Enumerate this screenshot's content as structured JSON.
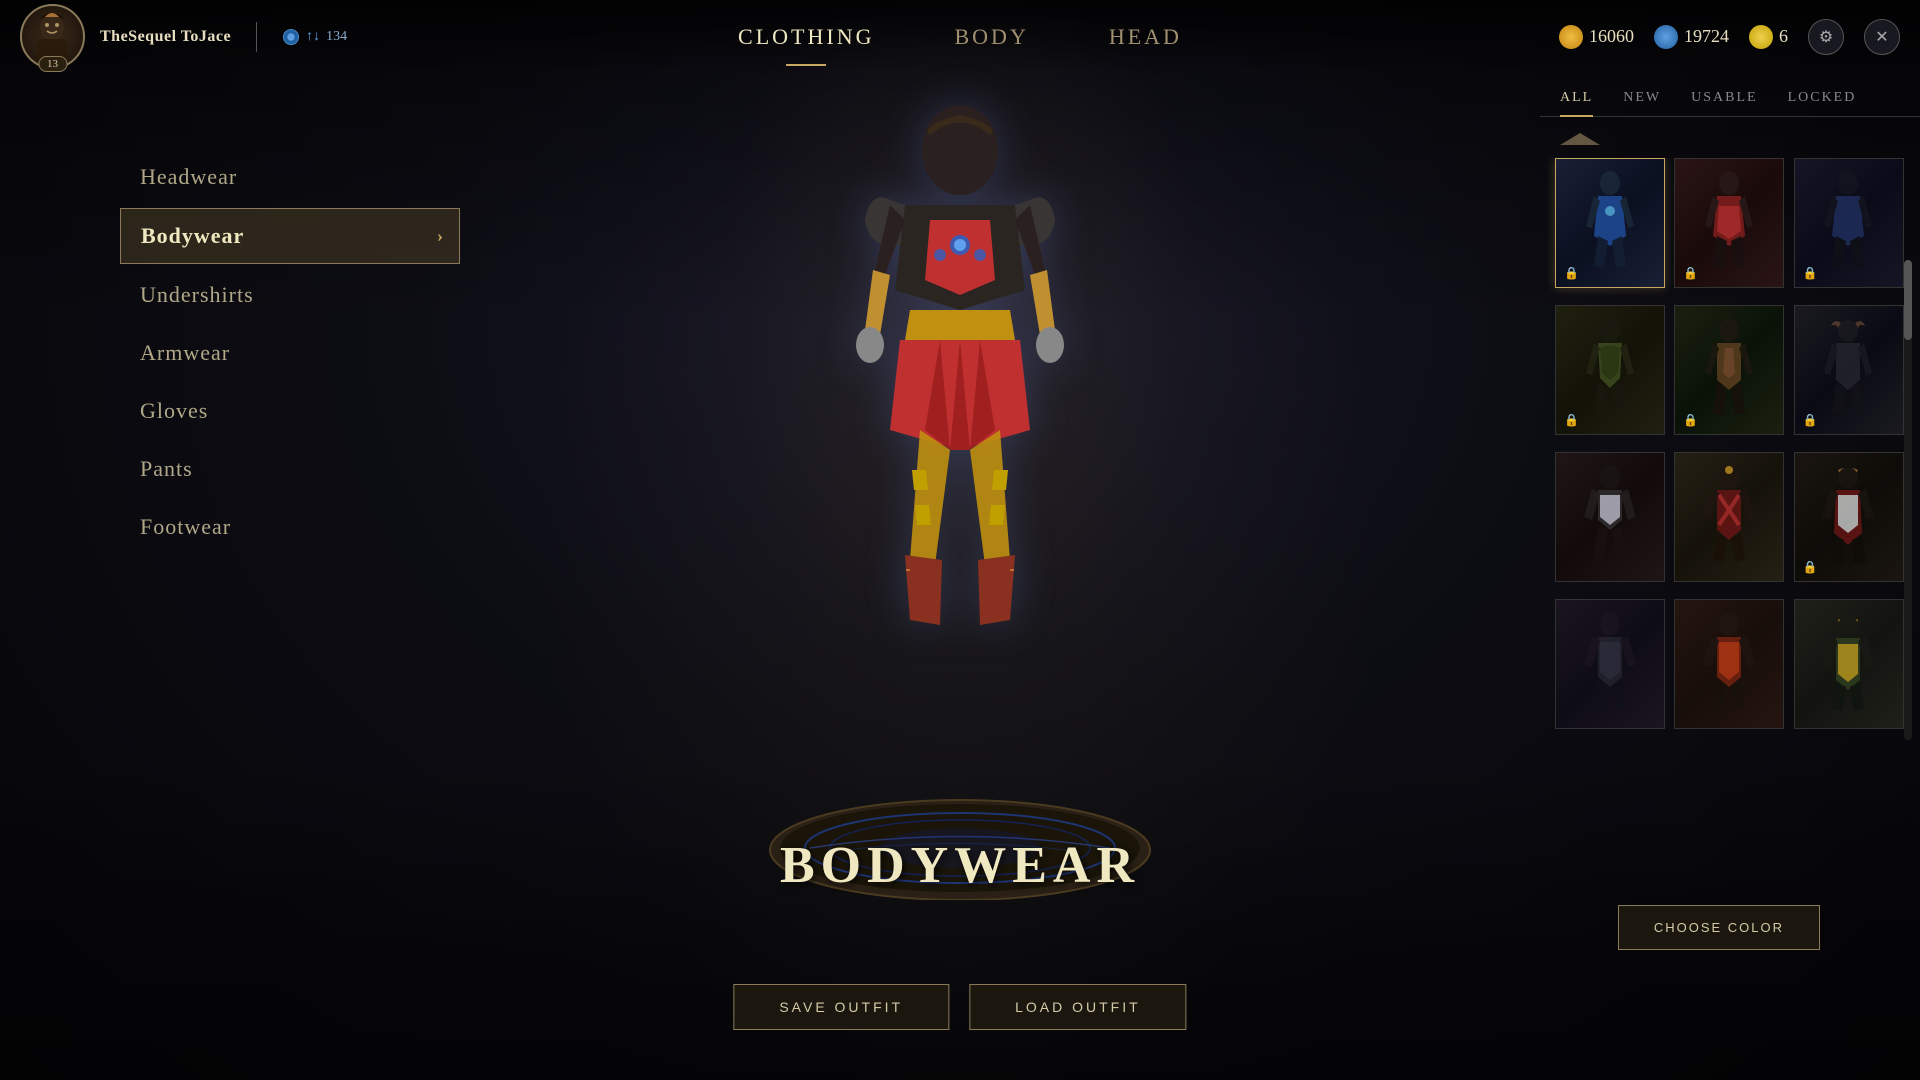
{
  "header": {
    "username": "TheSequel ToJace",
    "level": "13",
    "status_icon": "↑↓",
    "status_value": "134",
    "currency1": "16060",
    "currency2": "19724",
    "currency3": "6",
    "nav_tabs": [
      {
        "label": "CLOTHING",
        "active": true
      },
      {
        "label": "BODY",
        "active": false
      },
      {
        "label": "HEAD",
        "active": false
      }
    ]
  },
  "categories": [
    {
      "label": "Headwear",
      "active": false
    },
    {
      "label": "Bodywear",
      "active": true
    },
    {
      "label": "Undershirts",
      "active": false
    },
    {
      "label": "Armwear",
      "active": false
    },
    {
      "label": "Gloves",
      "active": false
    },
    {
      "label": "Pants",
      "active": false
    },
    {
      "label": "Footwear",
      "active": false
    }
  ],
  "filter_tabs": [
    {
      "label": "ALL",
      "active": true
    },
    {
      "label": "NEW",
      "active": false
    },
    {
      "label": "USABLE",
      "active": false
    },
    {
      "label": "LOCKED",
      "active": false
    }
  ],
  "section_title": "Bodywear",
  "buttons": {
    "save_outfit": "SAVE OUTFIT",
    "load_outfit": "LOAD OUTFIT",
    "choose_color": "CHOOSE COLOR"
  },
  "grid_items": [
    {
      "id": 1,
      "locked": true,
      "color_class": "item-color-1",
      "selected": true
    },
    {
      "id": 2,
      "locked": true,
      "color_class": "item-color-2",
      "selected": false
    },
    {
      "id": 3,
      "locked": true,
      "color_class": "item-color-3",
      "selected": false
    },
    {
      "id": 4,
      "locked": true,
      "color_class": "item-color-4",
      "selected": false
    },
    {
      "id": 5,
      "locked": true,
      "color_class": "item-color-5",
      "selected": false
    },
    {
      "id": 6,
      "locked": true,
      "color_class": "item-color-6",
      "selected": false
    },
    {
      "id": 7,
      "locked": false,
      "color_class": "item-color-7",
      "selected": false
    },
    {
      "id": 8,
      "locked": false,
      "color_class": "item-color-8",
      "selected": false
    },
    {
      "id": 9,
      "locked": true,
      "color_class": "item-color-9",
      "selected": false
    },
    {
      "id": 10,
      "locked": false,
      "color_class": "item-color-10",
      "selected": false
    },
    {
      "id": 11,
      "locked": false,
      "color_class": "item-color-11",
      "selected": false
    },
    {
      "id": 12,
      "locked": false,
      "color_class": "item-color-12",
      "selected": false
    }
  ]
}
